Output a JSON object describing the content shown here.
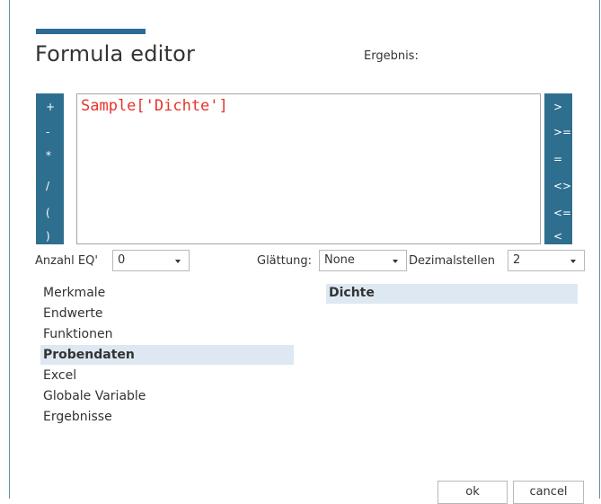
{
  "dialog": {
    "title": "Formula editor",
    "result_label": "Ergebnis:"
  },
  "operators_left": [
    "+",
    "-",
    "*",
    "/",
    "(",
    ")"
  ],
  "operators_right": [
    ">",
    ">=",
    "=",
    "<>",
    "<=",
    "<"
  ],
  "editor": {
    "text": "Sample['Dichte']"
  },
  "controls": {
    "anzahl_label": "Anzahl EQ'",
    "anzahl_value": "0",
    "glaettung_label": "Glättung:",
    "glaettung_value": "None",
    "dezimal_label": "Dezimalstellen",
    "dezimal_value": "2"
  },
  "categories": [
    {
      "label": "Merkmale",
      "selected": false
    },
    {
      "label": "Endwerte",
      "selected": false
    },
    {
      "label": "Funktionen",
      "selected": false
    },
    {
      "label": "Probendaten",
      "selected": true
    },
    {
      "label": "Excel",
      "selected": false
    },
    {
      "label": "Globale Variable",
      "selected": false
    },
    {
      "label": "Ergebnisse",
      "selected": false
    }
  ],
  "fields": [
    {
      "label": "Dichte",
      "selected": true
    }
  ],
  "buttons": {
    "ok": "ok",
    "cancel": "cancel"
  },
  "colors": {
    "accent": "#2d6b96",
    "operator_bg": "#2e6f8f",
    "formula_text": "#e8332a",
    "selection_bg": "#dde8f2"
  }
}
